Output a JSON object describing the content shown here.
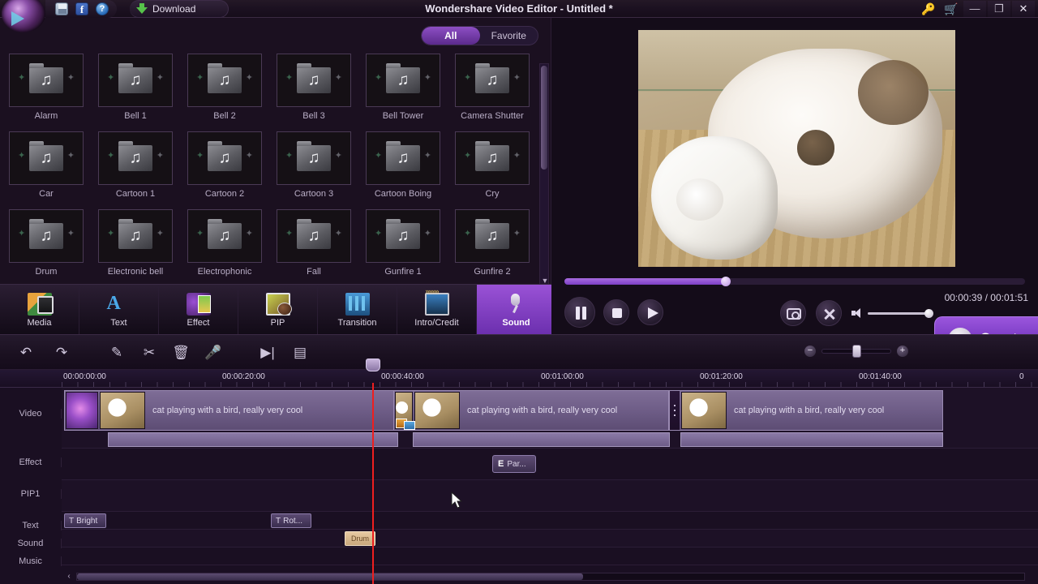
{
  "titlebar": {
    "title": "Wondershare Video Editor - Untitled *",
    "save_icon": "save-icon",
    "facebook_icon": "f",
    "help_icon": "?",
    "download_label": "Download",
    "key_icon": "key-icon",
    "cart_icon": "cart-icon",
    "minimize": "—",
    "maximize": "❐",
    "close": "✕"
  },
  "library": {
    "tabs": [
      {
        "label": "All",
        "active": true
      },
      {
        "label": "Favorite",
        "active": false
      }
    ],
    "items": [
      {
        "label": "Alarm"
      },
      {
        "label": "Bell 1"
      },
      {
        "label": "Bell 2"
      },
      {
        "label": "Bell 3"
      },
      {
        "label": "Bell Tower"
      },
      {
        "label": "Camera Shutter"
      },
      {
        "label": "Car"
      },
      {
        "label": "Cartoon 1"
      },
      {
        "label": "Cartoon 2"
      },
      {
        "label": "Cartoon 3"
      },
      {
        "label": "Cartoon Boing"
      },
      {
        "label": "Cry"
      },
      {
        "label": "Drum"
      },
      {
        "label": "Electronic bell"
      },
      {
        "label": "Electrophonic"
      },
      {
        "label": "Fall"
      },
      {
        "label": "Gunfire 1"
      },
      {
        "label": "Gunfire 2"
      }
    ],
    "scroll_up": "▲",
    "scroll_down": "▼"
  },
  "tooltabs": [
    {
      "label": "Media",
      "icon": "media-icon",
      "active": false
    },
    {
      "label": "Text",
      "icon": "text-icon",
      "active": false
    },
    {
      "label": "Effect",
      "icon": "effect-icon",
      "active": false
    },
    {
      "label": "PIP",
      "icon": "pip-icon",
      "active": false
    },
    {
      "label": "Transition",
      "icon": "transition-icon",
      "active": false
    },
    {
      "label": "Intro/Credit",
      "icon": "intro-credit-icon",
      "active": false
    },
    {
      "label": "Sound",
      "icon": "sound-icon",
      "active": true
    }
  ],
  "preview": {
    "timecode": "00:00:39 / 00:01:51",
    "pause_icon": "pause-icon",
    "stop_icon": "stop-icon",
    "play_icon": "play-icon",
    "snapshot_icon": "camera-icon",
    "fullscreen_icon": "fullscreen-icon",
    "volume_icon": "speaker-icon",
    "create_label": "Create"
  },
  "edit_toolbar": {
    "undo": "↶",
    "redo": "↷",
    "edit": "✎",
    "split": "✂",
    "delete": "🗑",
    "voiceover": "🎤",
    "fast_preview": "▶|",
    "capture": "▤",
    "zoom_out": "−",
    "zoom_in": "+"
  },
  "timeline": {
    "ruler_labels": [
      "00:00:00:00",
      "00:00:20:00",
      "00:00:40:00",
      "00:01:00:00",
      "00:01:20:00",
      "00:01:40:00",
      "0"
    ],
    "tracks": [
      {
        "name": "Video"
      },
      {
        "name": "Effect"
      },
      {
        "name": "PIP1"
      },
      {
        "name": "Text"
      },
      {
        "name": "Sound"
      },
      {
        "name": "Music"
      }
    ],
    "video_clips": [
      {
        "caption": "cat playing with a bird, really very cool"
      },
      {
        "caption": "cat playing with a bird, really very cool"
      },
      {
        "caption": "cat playing with a bird, really very cool"
      }
    ],
    "effect_clips": [
      {
        "glyph": "E",
        "label": "Par..."
      }
    ],
    "text_clips": [
      {
        "glyph": "T",
        "label": "Bright"
      },
      {
        "glyph": "T",
        "label": "Rot..."
      }
    ],
    "sound_clips": [
      {
        "label": "Drum"
      }
    ],
    "scroll_left": "‹"
  },
  "colors": {
    "accent": "#8d4fc4",
    "playhead": "#ee1f1f",
    "panel_bg": "#1b1020"
  }
}
